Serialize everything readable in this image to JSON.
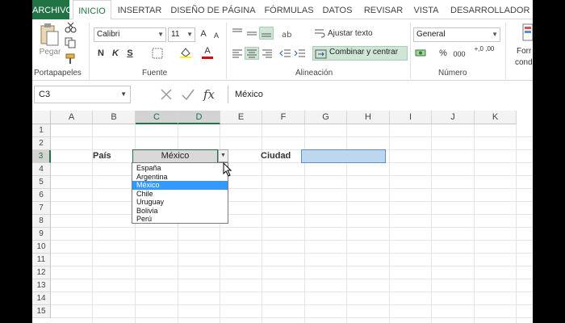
{
  "tabs": [
    {
      "label": "ARCHIVO"
    },
    {
      "label": "INICIO"
    },
    {
      "label": "INSERTAR"
    },
    {
      "label": "DISEÑO DE PÁGINA"
    },
    {
      "label": "FÓRMULAS"
    },
    {
      "label": "DATOS"
    },
    {
      "label": "REVISAR"
    },
    {
      "label": "VISTA"
    },
    {
      "label": "DESARROLLADOR"
    }
  ],
  "active_tab": "INICIO",
  "ribbon": {
    "clipboard": {
      "paste_label": "Pegar",
      "group_label": "Portapapeles"
    },
    "font": {
      "font_name": "Calibri",
      "font_size": "11",
      "grow_label": "A",
      "shrink_label": "A",
      "bold": "N",
      "italic": "K",
      "underline": "S",
      "font_color_label": "A",
      "group_label": "Fuente"
    },
    "alignment": {
      "wrap_label": "Ajustar texto",
      "merge_label": "Combinar y centrar",
      "group_label": "Alineación"
    },
    "number": {
      "format": "General",
      "percent": "%",
      "thousands": "000",
      "inc_decimal": "+,0 ,00",
      "group_label": "Número"
    },
    "styles": {
      "cond_label_1": "Forr",
      "cond_label_2": "condi"
    }
  },
  "formula_bar": {
    "name_box": "C3",
    "fx": "fx",
    "value": "México"
  },
  "columns": [
    "A",
    "B",
    "C",
    "D",
    "E",
    "F",
    "G",
    "H",
    "I",
    "J",
    "K"
  ],
  "selected_columns": [
    "C",
    "D"
  ],
  "rows": [
    "1",
    "2",
    "3",
    "4",
    "5",
    "6",
    "7",
    "8",
    "9",
    "10",
    "11",
    "12",
    "13",
    "14",
    "15"
  ],
  "selected_row": "3",
  "cells": {
    "pais_label": "País",
    "pais_value": "México",
    "ciudad_label": "Ciudad"
  },
  "dropdown": {
    "options": [
      "España",
      "Argentina",
      "México",
      "Chile",
      "Uruguay",
      "Bolivia",
      "Perú"
    ],
    "selected": "México"
  },
  "colors": {
    "excel_green": "#217346",
    "selection_blue": "#3399ff",
    "ciudad_fill": "#bdd7ee"
  }
}
